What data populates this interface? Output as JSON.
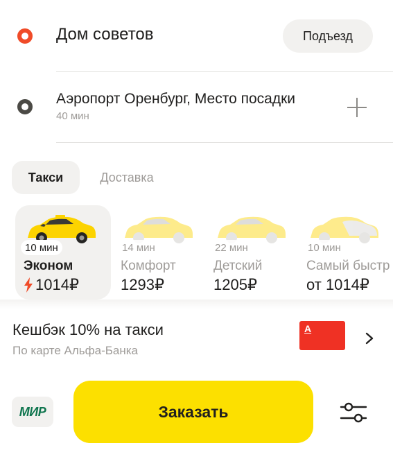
{
  "route": {
    "from": {
      "address": "Дом советов",
      "entrance_button": "Подъезд"
    },
    "to": {
      "address": "Аэропорт Оренбург, Место посадки",
      "eta": "40 мин"
    }
  },
  "tabs": [
    {
      "label": "Такси",
      "active": true
    },
    {
      "label": "Доставка",
      "active": false
    }
  ],
  "tariffs": [
    {
      "eta": "10 мин",
      "name": "Эконом",
      "price": "1014₽",
      "selected": true,
      "surge": true
    },
    {
      "eta": "14 мин",
      "name": "Комфорт",
      "price": "1293₽",
      "selected": false
    },
    {
      "eta": "22 мин",
      "name": "Детский",
      "price": "1205₽",
      "selected": false
    },
    {
      "eta": "10 мин",
      "name": "Самый быстр",
      "price": "от 1014₽",
      "selected": false
    }
  ],
  "cashback": {
    "title": "Кешбэк 10% на такси",
    "subtitle": "По карте Альфа-Банка",
    "card_letter": "А"
  },
  "footer": {
    "payment_method": "МИР",
    "order_button": "Заказать"
  },
  "colors": {
    "accent_yellow": "#fce000",
    "origin_dot": "#f04b28",
    "destination_dot": "#4b4a45",
    "bank_card": "#ef3124",
    "surge_bolt": "#f04b28",
    "taxi_car": "#fcd300"
  },
  "icons": {
    "plus": "plus-icon",
    "chevron": "chevron-right-icon",
    "settings": "sliders-icon",
    "surge": "bolt-icon"
  }
}
